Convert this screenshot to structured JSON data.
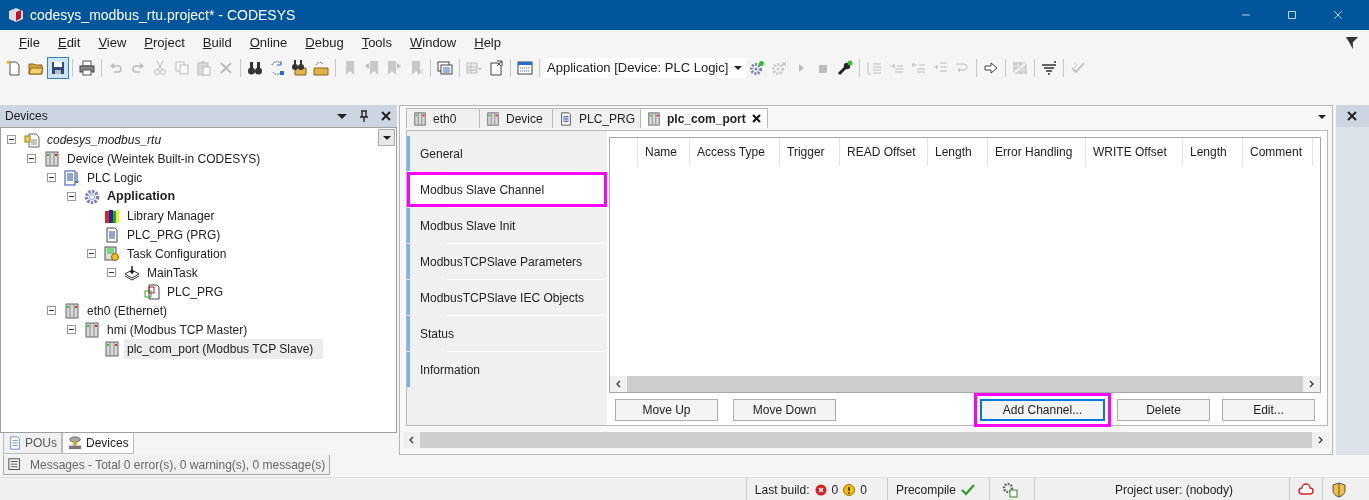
{
  "window": {
    "title": "codesys_modbus_rtu.project* - CODESYS"
  },
  "menu": [
    "File",
    "Edit",
    "View",
    "Project",
    "Build",
    "Online",
    "Debug",
    "Tools",
    "Window",
    "Help"
  ],
  "toolbar": {
    "items": [
      {
        "kind": "button",
        "disabled": false,
        "pressed": false
      },
      {
        "kind": "button",
        "disabled": false,
        "pressed": false
      },
      {
        "kind": "button",
        "disabled": false,
        "pressed": true
      },
      {
        "kind": "separator"
      },
      {
        "kind": "button",
        "disabled": false,
        "pressed": false
      },
      {
        "kind": "separator"
      },
      {
        "kind": "button",
        "disabled": true,
        "pressed": false
      },
      {
        "kind": "button",
        "disabled": true,
        "pressed": false
      },
      {
        "kind": "button",
        "disabled": true,
        "pressed": false
      },
      {
        "kind": "button",
        "disabled": true,
        "pressed": false
      },
      {
        "kind": "button",
        "disabled": true,
        "pressed": false
      },
      {
        "kind": "button",
        "disabled": true,
        "pressed": false
      },
      {
        "kind": "separator"
      },
      {
        "kind": "button",
        "disabled": false,
        "pressed": false
      },
      {
        "kind": "button",
        "disabled": false,
        "pressed": false
      },
      {
        "kind": "button",
        "disabled": false,
        "pressed": false
      },
      {
        "kind": "button",
        "disabled": false,
        "pressed": false
      },
      {
        "kind": "separator"
      },
      {
        "kind": "button",
        "disabled": true,
        "pressed": false
      },
      {
        "kind": "button",
        "disabled": true,
        "pressed": false
      },
      {
        "kind": "button",
        "disabled": true,
        "pressed": false
      },
      {
        "kind": "button",
        "disabled": true,
        "pressed": false
      },
      {
        "kind": "separator"
      },
      {
        "kind": "button",
        "disabled": false,
        "pressed": false
      },
      {
        "kind": "separator"
      },
      {
        "kind": "button",
        "disabled": true,
        "pressed": false
      },
      {
        "kind": "button",
        "disabled": false,
        "pressed": false
      },
      {
        "kind": "separator"
      },
      {
        "kind": "button",
        "disabled": false,
        "pressed": false
      },
      {
        "kind": "separator"
      },
      {
        "kind": "selector",
        "value": "Application [Device: PLC Logic]"
      },
      {
        "kind": "button",
        "disabled": false,
        "pressed": false
      },
      {
        "kind": "button",
        "disabled": true,
        "pressed": false
      },
      {
        "kind": "button",
        "disabled": true,
        "pressed": false
      },
      {
        "kind": "button",
        "disabled": true,
        "pressed": false
      },
      {
        "kind": "button",
        "disabled": false,
        "pressed": false
      },
      {
        "kind": "separator"
      },
      {
        "kind": "button",
        "disabled": true,
        "pressed": false
      },
      {
        "kind": "button",
        "disabled": true,
        "pressed": false
      },
      {
        "kind": "button",
        "disabled": true,
        "pressed": false
      },
      {
        "kind": "button",
        "disabled": true,
        "pressed": false
      },
      {
        "kind": "button",
        "disabled": true,
        "pressed": false
      },
      {
        "kind": "separator"
      },
      {
        "kind": "button",
        "disabled": false,
        "pressed": false
      },
      {
        "kind": "separator"
      },
      {
        "kind": "button",
        "disabled": true,
        "pressed": false
      },
      {
        "kind": "separator"
      },
      {
        "kind": "button",
        "disabled": false,
        "pressed": false
      },
      {
        "kind": "separator"
      },
      {
        "kind": "button",
        "disabled": true,
        "pressed": false
      }
    ]
  },
  "devices": {
    "title": "Devices",
    "tree": [
      {
        "label": "codesys_modbus_rtu",
        "kind": "project",
        "expanded": true,
        "selected": false,
        "children": [
          {
            "label": "Device (Weintek Built-in CODESYS)",
            "kind": "device",
            "expanded": true,
            "selected": false,
            "children": [
              {
                "label": "PLC Logic",
                "kind": "plc-logic",
                "expanded": true,
                "selected": false,
                "children": [
                  {
                    "label": "Application",
                    "kind": "application",
                    "expanded": true,
                    "selected": false,
                    "children": [
                      {
                        "label": "Library Manager",
                        "kind": "library",
                        "selected": false
                      },
                      {
                        "label": "PLC_PRG (PRG)",
                        "kind": "pou",
                        "selected": false
                      },
                      {
                        "label": "Task Configuration",
                        "kind": "tasks",
                        "expanded": true,
                        "selected": false,
                        "children": [
                          {
                            "label": "MainTask",
                            "kind": "task",
                            "expanded": true,
                            "selected": false,
                            "children": [
                              {
                                "label": "PLC_PRG",
                                "kind": "call",
                                "selected": false
                              }
                            ]
                          }
                        ]
                      }
                    ]
                  }
                ]
              },
              {
                "label": "eth0 (Ethernet)",
                "kind": "device",
                "expanded": true,
                "selected": false,
                "children": [
                  {
                    "label": "hmi (Modbus TCP Master)",
                    "kind": "device",
                    "expanded": true,
                    "selected": false,
                    "children": [
                      {
                        "label": "plc_com_port (Modbus TCP Slave)",
                        "kind": "device",
                        "selected": true
                      }
                    ]
                  }
                ]
              }
            ]
          }
        ]
      }
    ]
  },
  "bottom_tabs": [
    {
      "label": "POUs",
      "kind": "pous",
      "selected": false
    },
    {
      "label": "Devices",
      "kind": "devices",
      "selected": true
    }
  ],
  "editor": {
    "tabs": [
      {
        "label": "eth0",
        "kind": "device",
        "selected": false,
        "closable": false
      },
      {
        "label": "Device",
        "kind": "device",
        "selected": false,
        "closable": false
      },
      {
        "label": "PLC_PRG",
        "kind": "pou",
        "selected": false,
        "closable": false
      },
      {
        "label": "plc_com_port",
        "kind": "device",
        "selected": true,
        "closable": true
      }
    ],
    "nav": [
      {
        "label": "General",
        "selected": false,
        "highlighted": false
      },
      {
        "label": "Modbus Slave Channel",
        "selected": true,
        "highlighted": true
      },
      {
        "label": "Modbus Slave Init",
        "selected": false,
        "highlighted": false
      },
      {
        "label": "ModbusTCPSlave Parameters",
        "selected": false,
        "highlighted": false
      },
      {
        "label": "ModbusTCPSlave IEC Objects",
        "selected": false,
        "highlighted": false
      },
      {
        "label": "Status",
        "selected": false,
        "highlighted": false
      },
      {
        "label": "Information",
        "selected": false,
        "highlighted": false
      }
    ],
    "table": {
      "columns": [
        "Name",
        "Access Type",
        "Trigger",
        "READ Offset",
        "Length",
        "Error Handling",
        "WRITE Offset",
        "Length",
        "Comment"
      ]
    },
    "buttons_left": [
      {
        "label": "Move Up",
        "focused": false,
        "highlighted": false
      },
      {
        "label": "Move Down",
        "focused": false,
        "highlighted": false
      }
    ],
    "buttons_right": [
      {
        "label": "Add Channel...",
        "focused": true,
        "highlighted": true
      },
      {
        "label": "Delete",
        "focused": false,
        "highlighted": false
      },
      {
        "label": "Edit...",
        "focused": false,
        "highlighted": false
      }
    ]
  },
  "messages_tab": "Messages - Total 0 error(s), 0 warning(s), 0 message(s)",
  "status_bar": {
    "last_build_label": "Last build:",
    "errors": "0",
    "warnings": "0",
    "precompile": "Precompile",
    "precompile_ok": true,
    "project_user": "Project user: (nobody)"
  }
}
